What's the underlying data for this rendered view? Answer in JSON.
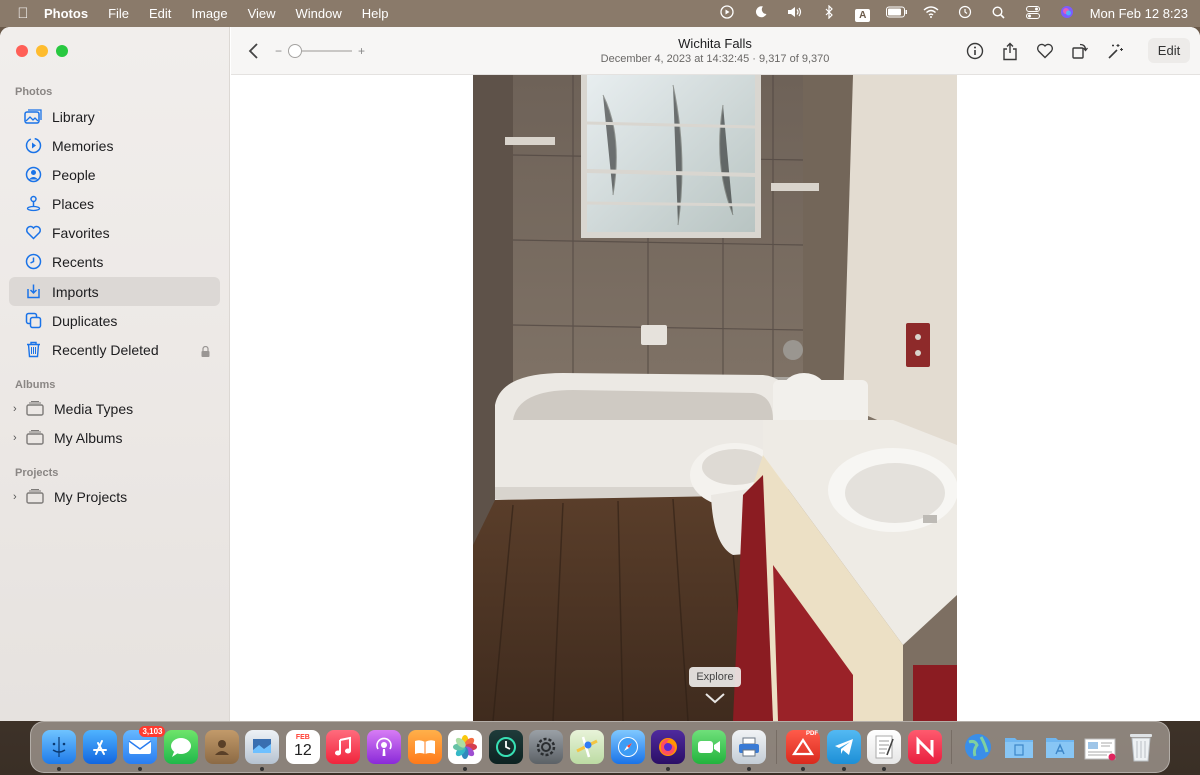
{
  "menubar": {
    "app_name": "Photos",
    "menus": [
      "File",
      "Edit",
      "Image",
      "View",
      "Window",
      "Help"
    ],
    "input_source": "A",
    "clock": "Mon Feb 12  8:23"
  },
  "sidebar": {
    "photos_label": "Photos",
    "items": [
      {
        "label": "Library"
      },
      {
        "label": "Memories"
      },
      {
        "label": "People"
      },
      {
        "label": "Places"
      },
      {
        "label": "Favorites"
      },
      {
        "label": "Recents"
      },
      {
        "label": "Imports"
      },
      {
        "label": "Duplicates"
      },
      {
        "label": "Recently Deleted"
      }
    ],
    "albums_label": "Albums",
    "albums": [
      {
        "label": "Media Types"
      },
      {
        "label": "My Albums"
      }
    ],
    "projects_label": "Projects",
    "projects": [
      {
        "label": "My Projects"
      }
    ]
  },
  "toolbar": {
    "zoom_minus": "−",
    "zoom_plus": "+",
    "title": "Wichita Falls",
    "subtitle": "December 4, 2023 at 14:32:45  ·  9,317 of 9,370",
    "edit_label": "Edit"
  },
  "viewer": {
    "explore_label": "Explore"
  },
  "dock": {
    "mail_badge": "3,103",
    "calendar_month": "FEB",
    "calendar_day": "12",
    "pdf_label": "PDF"
  },
  "colors": {
    "accent": "#1a73e8",
    "selected_row": "#dcd8d5",
    "close": "#ff5f57",
    "minimize": "#febc2e",
    "maximize": "#28c840"
  }
}
